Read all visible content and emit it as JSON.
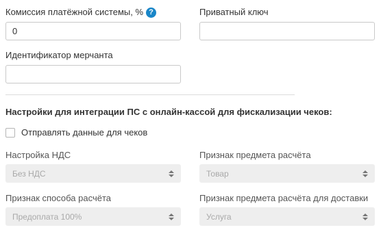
{
  "commission": {
    "label": "Комиссия платёжной системы, %",
    "value": "0",
    "help_icon": "?"
  },
  "private_key": {
    "label": "Приватный ключ",
    "value": ""
  },
  "merchant_id": {
    "label": "Идентификатор мерчанта",
    "value": ""
  },
  "fiscal": {
    "section_title": "Настройки для интеграции ПС с онлайн-кассой для фискализации чеков:",
    "send_checkbox_label": "Отправлять данные для чеков",
    "send_checkbox_checked": false,
    "vat": {
      "label": "Настройка НДС",
      "value": "Без НДС"
    },
    "subject": {
      "label": "Признак предмета расчёта",
      "value": "Товар"
    },
    "method": {
      "label": "Признак способа расчёта",
      "value": "Предоплата 100%"
    },
    "delivery_subject": {
      "label": "Признак предмета расчёта для доставки",
      "value": "Услуга"
    }
  },
  "icons": {
    "help": "question-circle-icon",
    "select_arrows": "up-down-arrows-icon"
  },
  "colors": {
    "help_icon": "#1a86c8",
    "disabled_select_bg": "#eeeeee",
    "disabled_select_text": "#a9a9a9"
  }
}
